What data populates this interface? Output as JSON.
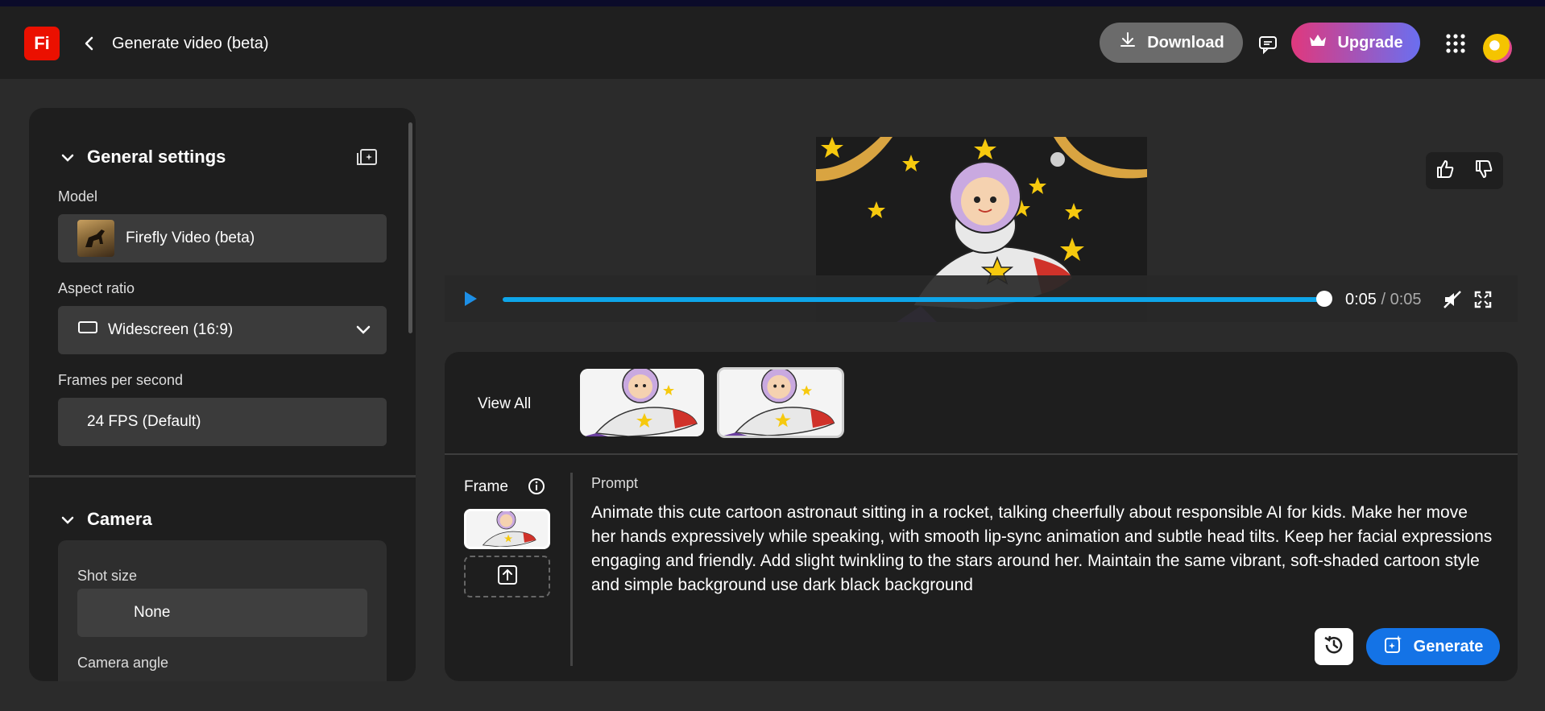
{
  "app": {
    "logo_text": "Fi",
    "title": "Generate video (beta)"
  },
  "header": {
    "download_label": "Download",
    "upgrade_label": "Upgrade",
    "brand_gradient": [
      "#e0387d",
      "#6a6ff0"
    ]
  },
  "sidebar": {
    "general_title": "General settings",
    "model_label": "Model",
    "model_value": "Firefly Video (beta)",
    "aspect_label": "Aspect ratio",
    "aspect_value": "Widescreen (16:9)",
    "fps_label": "Frames per second",
    "fps_value": "24 FPS (Default)",
    "camera_title": "Camera",
    "shot_size_label": "Shot size",
    "shot_size_value": "None",
    "camera_angle_label": "Camera angle"
  },
  "player": {
    "current_time": "0:05",
    "separator": " / ",
    "total_time": "0:05",
    "progress_fraction": 1.0,
    "accent_color": "#0ea5e9"
  },
  "gallery": {
    "view_all_label": "View All"
  },
  "composer": {
    "frame_label": "Frame",
    "prompt_label": "Prompt",
    "prompt_text": "Animate this cute cartoon astronaut sitting in a rocket, talking cheerfully about responsible AI for kids. Make her move her hands expressively while speaking, with smooth lip-sync animation and subtle head tilts. Keep her facial expressions engaging and friendly. Add slight twinkling to the stars around her. Maintain the same vibrant, soft-shaded cartoon style and simple background use dark black background",
    "generate_label": "Generate",
    "generate_color": "#1473e6"
  },
  "icons": [
    "chevron-left-icon",
    "download-icon",
    "comment-icon",
    "crown-icon",
    "apps-grid-icon",
    "avatar",
    "chevron-down-icon",
    "settings-panel-icon",
    "widescreen-icon",
    "play-icon",
    "mute-icon",
    "fullscreen-icon",
    "thumbs-up-icon",
    "thumbs-down-icon",
    "info-icon",
    "upload-icon",
    "history-icon",
    "generate-sparkle-icon"
  ]
}
